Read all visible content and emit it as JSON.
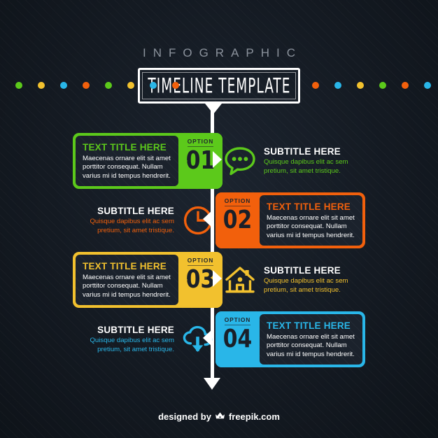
{
  "header": {
    "kicker": "INFOGRAPHIC",
    "title": "TIMELINE TEMPLATE"
  },
  "colors": {
    "green": "#5cc91b",
    "orange": "#f2600c",
    "yellow": "#f2c12e",
    "blue": "#29b6e8",
    "background": "#151c25",
    "panel": "#1b222c",
    "white": "#ffffff",
    "kicker_gray": "#8b929c"
  },
  "dots": {
    "left": [
      "#5cc91b",
      "#f2c12e",
      "#29b6e8",
      "#f2600c",
      "#5cc91b",
      "#f2c12e",
      "#29b6e8",
      "#f2600c"
    ],
    "right": [
      "#f2600c",
      "#29b6e8",
      "#f2c12e",
      "#5cc91b",
      "#f2600c",
      "#29b6e8",
      "#f2c12e",
      "#5cc91b"
    ]
  },
  "rows": [
    {
      "option_label": "OPTION",
      "number": "01",
      "color": "#5cc91b",
      "card_side": "left",
      "card_title": "TEXT TITLE HERE",
      "card_text": "Maecenas ornare elit sit amet porttitor consequat. Nullam varius mi id tempus hendrerit.",
      "sub_title": "SUBTITLE HERE",
      "sub_text": "Quisque dapibus elit ac sem pretium, sit amet tristique.",
      "icon": "speech-bubble-icon"
    },
    {
      "option_label": "OPTION",
      "number": "02",
      "color": "#f2600c",
      "card_side": "right",
      "card_title": "TEXT TITLE HERE",
      "card_text": "Maecenas ornare elit sit amet porttitor consequat. Nullam varius mi id tempus hendrerit.",
      "sub_title": "SUBTITLE HERE",
      "sub_text": "Quisque dapibus elit ac sem pretium, sit amet tristique.",
      "icon": "clock-icon"
    },
    {
      "option_label": "OPTION",
      "number": "03",
      "color": "#f2c12e",
      "card_side": "left",
      "card_title": "TEXT TITLE HERE",
      "card_text": "Maecenas ornare elit sit amet porttitor consequat. Nullam varius mi id tempus hendrerit.",
      "sub_title": "SUBTITLE HERE",
      "sub_text": "Quisque dapibus elit ac sem pretium, sit amet tristique.",
      "icon": "house-icon"
    },
    {
      "option_label": "OPTION",
      "number": "04",
      "color": "#29b6e8",
      "card_side": "right",
      "card_title": "TEXT TITLE HERE",
      "card_text": "Maecenas ornare elit sit amet porttitor consequat. Nullam varius mi id tempus hendrerit.",
      "sub_title": "SUBTITLE HERE",
      "sub_text": "Quisque dapibus elit ac sem pretium, sit amet tristique.",
      "icon": "cloud-download-icon"
    }
  ],
  "footer": {
    "prefix": "designed by",
    "brand": "freepik.com"
  }
}
